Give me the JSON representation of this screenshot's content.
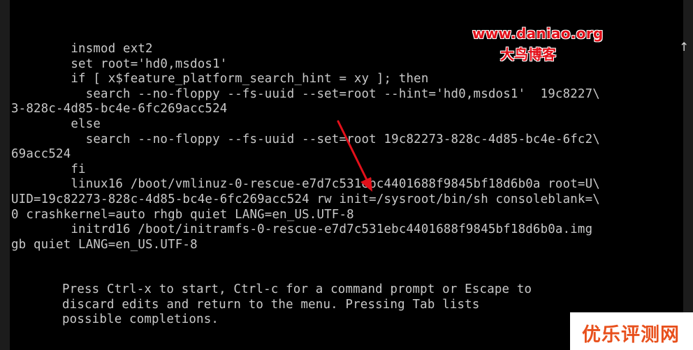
{
  "editor": {
    "lines": [
      "        insmod ext2",
      "        set root='hd0,msdos1'",
      "        if [ x$feature_platform_search_hint = xy ]; then",
      "          search --no-floppy --fs-uuid --set=root --hint='hd0,msdos1'  19c8227\\",
      "3-828c-4d85-bc4e-6fc269acc524",
      "        else",
      "          search --no-floppy --fs-uuid --set=root 19c82273-828c-4d85-bc4e-6fc2\\",
      "69acc524",
      "        fi",
      "        linux16 /boot/vmlinuz-0-rescue-e7d7c531ebc4401688f9845bf18d6b0a root=U\\",
      "UID=19c82273-828c-4d85-bc4e-6fc269acc524 rw init=/sysroot/bin/sh consoleblank=\\",
      "0 crashkernel=auto rhgb quiet LANG=en_US.UTF-8",
      "        initrd16 /boot/initramfs-0-rescue-e7d7c531ebc4401688f9845bf18d6b0a.img",
      "gb quiet LANG=en_US.UTF-8"
    ],
    "scroll_indicator": "↑"
  },
  "help": {
    "lines": [
      "Press Ctrl-x to start, Ctrl-c for a command prompt or Escape to",
      "discard edits and return to the menu. Pressing Tab lists",
      "possible completions."
    ]
  },
  "watermark": {
    "site": "www.daniao.org",
    "name": "大鸟博客"
  },
  "badge": {
    "text": "优乐评测网"
  },
  "colors": {
    "console_bg": "#000000",
    "console_text": "#c9c9c9",
    "arrow": "#e3101a",
    "watermark": "#e3101a",
    "badge_text": "#e8501c"
  }
}
